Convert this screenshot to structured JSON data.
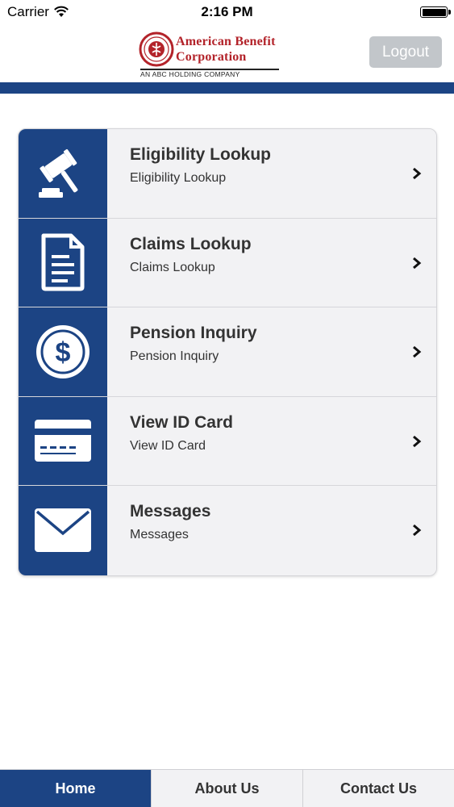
{
  "status_bar": {
    "carrier": "Carrier",
    "time": "2:16 PM"
  },
  "header": {
    "logo": {
      "line1": "American Benefit",
      "line2": "Corporation",
      "subline": "AN ABC HOLDING COMPANY"
    },
    "logout_label": "Logout"
  },
  "colors": {
    "brand_blue": "#1c4484",
    "logo_red": "#b3232a",
    "logout_bg": "#c2c6ca"
  },
  "menu": {
    "items": [
      {
        "title": "Eligibility Lookup",
        "subtitle": "Eligibility Lookup",
        "icon": "gavel-icon"
      },
      {
        "title": "Claims Lookup",
        "subtitle": "Claims Lookup",
        "icon": "document-icon"
      },
      {
        "title": "Pension Inquiry",
        "subtitle": "Pension Inquiry",
        "icon": "dollar-coin-icon"
      },
      {
        "title": "View ID Card",
        "subtitle": "View ID Card",
        "icon": "id-card-icon"
      },
      {
        "title": "Messages",
        "subtitle": "Messages",
        "icon": "envelope-icon"
      }
    ]
  },
  "tabs": [
    {
      "label": "Home",
      "active": true
    },
    {
      "label": "About Us",
      "active": false
    },
    {
      "label": "Contact Us",
      "active": false
    }
  ]
}
